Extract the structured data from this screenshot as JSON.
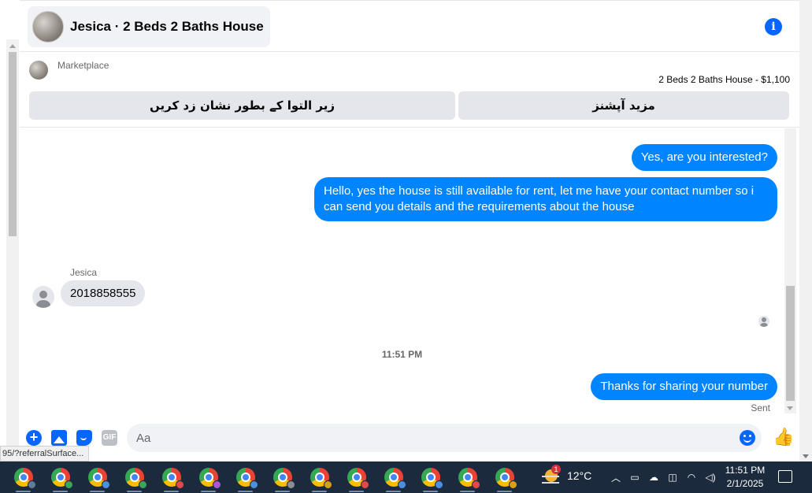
{
  "chat": {
    "title": "Jesica · 2 Beds 2 Baths House",
    "marketplace_label": "Marketplace",
    "listing": "2 Beds 2 Baths House - $1,100",
    "mark_pending_button": "زیر التوا کے بطور نشان زد کریں",
    "more_options_button": "مزید آپشنز",
    "messages": [
      {
        "from": "me",
        "text": "Yes, are you interested?"
      },
      {
        "from": "me",
        "text": "Hello, yes the house is still available for rent, let me have your contact number so i can send you details and the requirements about the house"
      },
      {
        "from": "Jesica",
        "text": "2018858555"
      },
      {
        "from": "me",
        "text": "Thanks for sharing your number"
      }
    ],
    "sender_name": "Jesica",
    "time_separator": "11:51 PM",
    "sent_status": "Sent",
    "composer_placeholder": "Aa",
    "gif_label": "GIF"
  },
  "status_bar_url": "95/?referralSurface...",
  "taskbar": {
    "app_count": 14,
    "weather_temp": "12°C",
    "weather_badge": "1",
    "clock_time": "11:51 PM",
    "clock_date": "2/1/2025",
    "badge_colors": [
      "#5f7d95",
      "#3ba55d",
      "#4a8fe0",
      "#3ba55d",
      "#e24a4a",
      "#a45ad8",
      "#4a8fe0",
      "#8a8d91",
      "#d4a017",
      "#e24a4a",
      "#4a8fe0",
      "#4a8fe0",
      "#e24a4a",
      "#d4a017"
    ]
  },
  "colors": {
    "accent": "#0084ff",
    "taskbar": "#1c2a3d"
  }
}
